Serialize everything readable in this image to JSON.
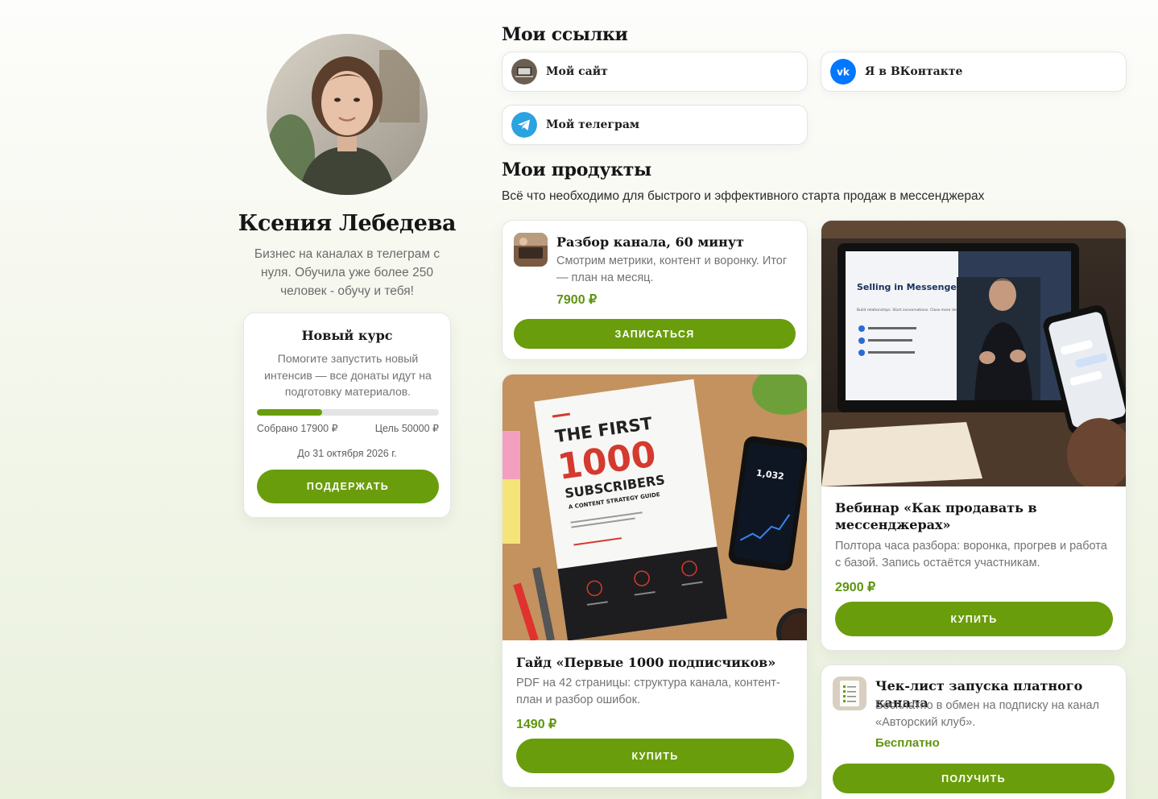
{
  "profile": {
    "name": "Ксения Лебедева",
    "bio": "Бизнес на каналах в телеграм с нуля. Обучила уже более 250 человек - обучу и тебя!"
  },
  "donation": {
    "title": "Новый курс",
    "description": "Помогите запустить новый интенсив — все донаты идут на подготовку материалов.",
    "collected_label": "Собрано 17900 ₽",
    "goal_label": "Цель 50000 ₽",
    "progress_fraction": 0.358,
    "deadline": "До 31 октября 2026 г.",
    "button_label": "ПОДДЕРЖАТЬ"
  },
  "links": {
    "heading": "Мои ссылки",
    "items": [
      {
        "label": "Мой сайт",
        "icon": "laptop-photo-icon"
      },
      {
        "label": "Я в ВКонтакте",
        "icon": "vk-icon",
        "color": "#0077ff"
      },
      {
        "label": "Мой телеграм",
        "icon": "telegram-icon",
        "color": "#2aa3e0"
      }
    ]
  },
  "products": {
    "heading": "Мои продукты",
    "subtitle": "Всё что необходимо для быстрого и эффективного старта продаж в мессенджерах",
    "items": [
      {
        "title": "Разбор канала, 60 минут",
        "description": "Смотрим метрики, контент и воронку. Итог — план на месяц.",
        "price": "7900 ₽",
        "button": "ЗАПИСАТЬСЯ"
      },
      {
        "title": "Вебинар «Как продавать в мессенджерах»",
        "description": "Полтора часа разбора: воронка, прогрев и работа с базой. Запись остаётся участникам.",
        "price": "2900 ₽",
        "button": "КУПИТЬ",
        "cover": {
          "slide_title": "Selling in Messengers",
          "slide_sub": "Build relationships. Start conversations. Close more deals."
        }
      },
      {
        "title": "Гайд «Первые 1000 подписчиков»",
        "description": "PDF на 42 страницы: структура канала, контент-план и разбор ошибок.",
        "price": "1490 ₽",
        "button": "КУПИТЬ",
        "cover": {
          "line1": "THE FIRST",
          "line2": "1000",
          "line3": "SUBSCRIBERS",
          "line4": "A CONTENT STRATEGY GUIDE",
          "phone_value": "1,032"
        }
      },
      {
        "title": "Чек-лист запуска платного канала",
        "description": "Бесплатно в обмен на подписку на канал «Авторский клуб».",
        "price": "Бесплатно",
        "button": "ПОЛУЧИТЬ"
      }
    ]
  },
  "colors": {
    "accent": "#6a9d0b",
    "price": "#5f9410"
  }
}
